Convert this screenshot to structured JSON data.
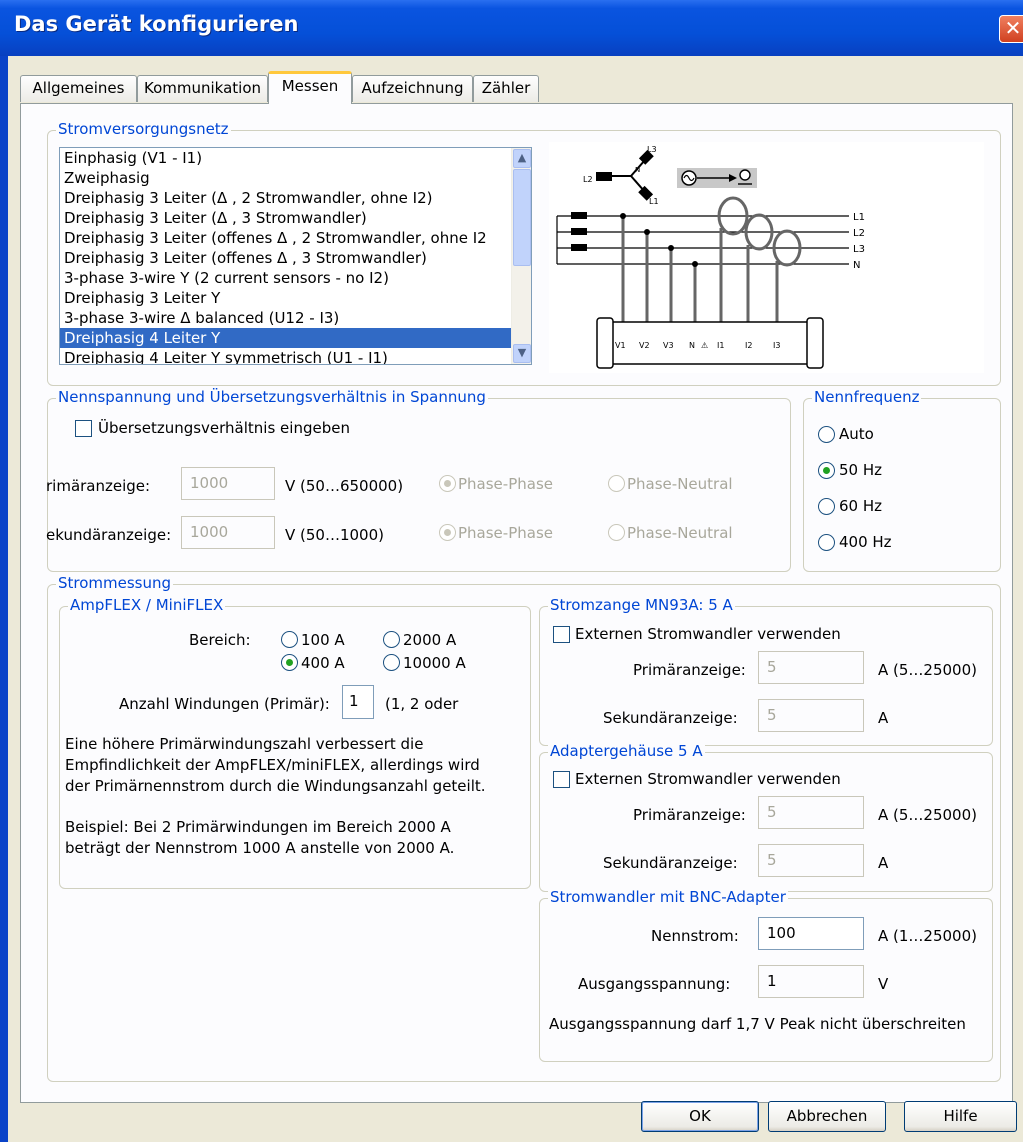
{
  "window": {
    "title": "Das Gerät konfigurieren",
    "close_glyph": "✕"
  },
  "tabs": [
    {
      "label": "Allgemeines"
    },
    {
      "label": "Kommunikation"
    },
    {
      "label": "Messen"
    },
    {
      "label": "Aufzeichnung"
    },
    {
      "label": "Zähler"
    }
  ],
  "network": {
    "legend": "Stromversorgungsnetz",
    "items": [
      "Einphasig (V1 - I1)",
      "Zweiphasig",
      "Dreiphasig 3 Leiter (Δ , 2 Stromwandler, ohne I2)",
      "Dreiphasig 3 Leiter (Δ , 3 Stromwandler)",
      "Dreiphasig 3 Leiter (offenes  Δ , 2 Stromwandler, ohne I2",
      "Dreiphasig 3 Leiter (offenes  Δ , 3 Stromwandler)",
      "3-phase 3-wire Y (2 current sensors - no I2)",
      "Dreiphasig 3 Leiter Y",
      "3-phase 3-wire Δ balanced (U12 - I3)",
      "Dreiphasig 4 Leiter Y",
      "Dreiphasig 4 Leiter Y symmetrisch (U1 - I1)"
    ],
    "selected_index": 9,
    "diagram": {
      "star_labels": [
        "L3",
        "L2",
        "N",
        "L1"
      ],
      "line_labels": [
        "L1",
        "L2",
        "L3",
        "N"
      ],
      "terminal_labels": [
        "V1",
        "V2",
        "V3",
        "N",
        "⚠",
        "I1",
        "I2",
        "I3"
      ]
    }
  },
  "voltage": {
    "legend": "Nennspannung und Übersetzungsverhältnis in Spannung",
    "ratio_checkbox": "Übersetzungsverhältnis eingeben",
    "primary_label": "rimäranzeige:",
    "primary_value": "1000",
    "primary_range": "V (50…650000)",
    "secondary_label": "ekundäranzeige:",
    "secondary_value": "1000",
    "secondary_range": "V (50…1000)",
    "phase_phase": "Phase-Phase",
    "phase_neutral": "Phase-Neutral"
  },
  "frequency": {
    "legend": "Nennfrequenz",
    "options": [
      "Auto",
      "50 Hz",
      "60 Hz",
      "400 Hz"
    ],
    "selected": "50 Hz"
  },
  "current": {
    "legend": "Strommessung",
    "ampflex": {
      "legend": "AmpFLEX / MiniFLEX",
      "range_label": "Bereich:",
      "ranges": [
        "100 A",
        "2000 A",
        "400 A",
        "10000 A"
      ],
      "selected_range": "400 A",
      "turns_label": "Anzahl Windungen (Primär):",
      "turns_value": "1",
      "turns_hint": "(1, 2 oder",
      "info1": [
        "Eine höhere Primärwindungszahl verbessert die",
        "Empfindlichkeit der AmpFLEX/miniFLEX, allerdings wird",
        "der Primärnennstrom durch die Windungsanzahl geteilt."
      ],
      "info2": [
        "Beispiel: Bei 2 Primärwindungen im Bereich 2000 A",
        "beträgt der Nennstrom 1000 A anstelle von 2000 A."
      ]
    },
    "clamp": {
      "legend": "Stromzange MN93A: 5 A",
      "checkbox": "Externen Stromwandler verwenden",
      "primary_label": "Primäranzeige:",
      "primary_value": "5",
      "primary_range": "A (5…25000)",
      "secondary_label": "Sekundäranzeige:",
      "secondary_value": "5",
      "secondary_unit": "A"
    },
    "adapter": {
      "legend": "Adaptergehäuse 5 A",
      "checkbox": "Externen Stromwandler verwenden",
      "primary_label": "Primäranzeige:",
      "primary_value": "5",
      "primary_range": "A (5…25000)",
      "secondary_label": "Sekundäranzeige:",
      "secondary_value": "5",
      "secondary_unit": "A"
    },
    "bnc": {
      "legend": "Stromwandler mit  BNC-Adapter",
      "nominal_label": "Nennstrom:",
      "nominal_value": "100",
      "nominal_range": "A (1…25000)",
      "output_label": "Ausgangsspannung:",
      "output_value": "1",
      "output_unit": "V",
      "note": "Ausgangsspannung darf 1,7 V Peak nicht überschreiten"
    }
  },
  "buttons": {
    "ok": "OK",
    "cancel": "Abbrechen",
    "help": "Hilfe"
  }
}
